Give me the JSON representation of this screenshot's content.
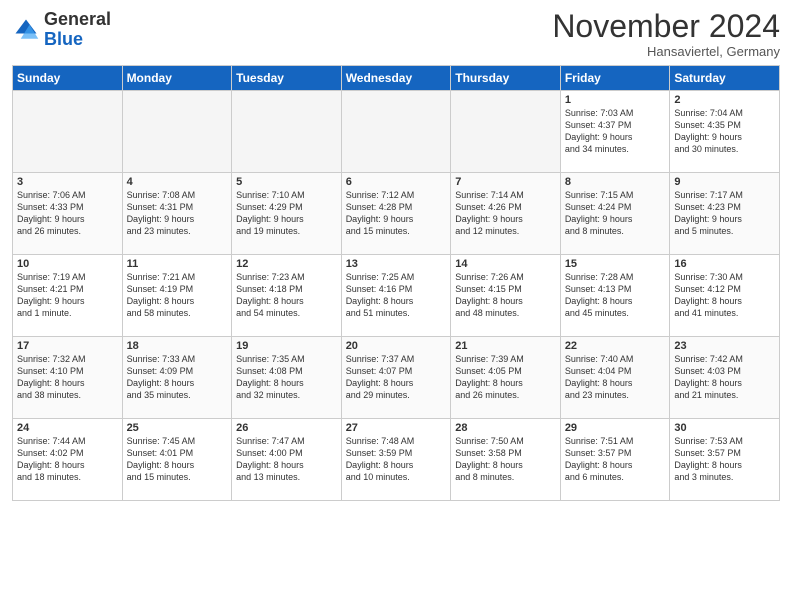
{
  "header": {
    "logo_general": "General",
    "logo_blue": "Blue",
    "month_title": "November 2024",
    "location": "Hansaviertel, Germany"
  },
  "columns": [
    "Sunday",
    "Monday",
    "Tuesday",
    "Wednesday",
    "Thursday",
    "Friday",
    "Saturday"
  ],
  "weeks": [
    [
      {
        "day": "",
        "info": ""
      },
      {
        "day": "",
        "info": ""
      },
      {
        "day": "",
        "info": ""
      },
      {
        "day": "",
        "info": ""
      },
      {
        "day": "",
        "info": ""
      },
      {
        "day": "1",
        "info": "Sunrise: 7:03 AM\nSunset: 4:37 PM\nDaylight: 9 hours\nand 34 minutes."
      },
      {
        "day": "2",
        "info": "Sunrise: 7:04 AM\nSunset: 4:35 PM\nDaylight: 9 hours\nand 30 minutes."
      }
    ],
    [
      {
        "day": "3",
        "info": "Sunrise: 7:06 AM\nSunset: 4:33 PM\nDaylight: 9 hours\nand 26 minutes."
      },
      {
        "day": "4",
        "info": "Sunrise: 7:08 AM\nSunset: 4:31 PM\nDaylight: 9 hours\nand 23 minutes."
      },
      {
        "day": "5",
        "info": "Sunrise: 7:10 AM\nSunset: 4:29 PM\nDaylight: 9 hours\nand 19 minutes."
      },
      {
        "day": "6",
        "info": "Sunrise: 7:12 AM\nSunset: 4:28 PM\nDaylight: 9 hours\nand 15 minutes."
      },
      {
        "day": "7",
        "info": "Sunrise: 7:14 AM\nSunset: 4:26 PM\nDaylight: 9 hours\nand 12 minutes."
      },
      {
        "day": "8",
        "info": "Sunrise: 7:15 AM\nSunset: 4:24 PM\nDaylight: 9 hours\nand 8 minutes."
      },
      {
        "day": "9",
        "info": "Sunrise: 7:17 AM\nSunset: 4:23 PM\nDaylight: 9 hours\nand 5 minutes."
      }
    ],
    [
      {
        "day": "10",
        "info": "Sunrise: 7:19 AM\nSunset: 4:21 PM\nDaylight: 9 hours\nand 1 minute."
      },
      {
        "day": "11",
        "info": "Sunrise: 7:21 AM\nSunset: 4:19 PM\nDaylight: 8 hours\nand 58 minutes."
      },
      {
        "day": "12",
        "info": "Sunrise: 7:23 AM\nSunset: 4:18 PM\nDaylight: 8 hours\nand 54 minutes."
      },
      {
        "day": "13",
        "info": "Sunrise: 7:25 AM\nSunset: 4:16 PM\nDaylight: 8 hours\nand 51 minutes."
      },
      {
        "day": "14",
        "info": "Sunrise: 7:26 AM\nSunset: 4:15 PM\nDaylight: 8 hours\nand 48 minutes."
      },
      {
        "day": "15",
        "info": "Sunrise: 7:28 AM\nSunset: 4:13 PM\nDaylight: 8 hours\nand 45 minutes."
      },
      {
        "day": "16",
        "info": "Sunrise: 7:30 AM\nSunset: 4:12 PM\nDaylight: 8 hours\nand 41 minutes."
      }
    ],
    [
      {
        "day": "17",
        "info": "Sunrise: 7:32 AM\nSunset: 4:10 PM\nDaylight: 8 hours\nand 38 minutes."
      },
      {
        "day": "18",
        "info": "Sunrise: 7:33 AM\nSunset: 4:09 PM\nDaylight: 8 hours\nand 35 minutes."
      },
      {
        "day": "19",
        "info": "Sunrise: 7:35 AM\nSunset: 4:08 PM\nDaylight: 8 hours\nand 32 minutes."
      },
      {
        "day": "20",
        "info": "Sunrise: 7:37 AM\nSunset: 4:07 PM\nDaylight: 8 hours\nand 29 minutes."
      },
      {
        "day": "21",
        "info": "Sunrise: 7:39 AM\nSunset: 4:05 PM\nDaylight: 8 hours\nand 26 minutes."
      },
      {
        "day": "22",
        "info": "Sunrise: 7:40 AM\nSunset: 4:04 PM\nDaylight: 8 hours\nand 23 minutes."
      },
      {
        "day": "23",
        "info": "Sunrise: 7:42 AM\nSunset: 4:03 PM\nDaylight: 8 hours\nand 21 minutes."
      }
    ],
    [
      {
        "day": "24",
        "info": "Sunrise: 7:44 AM\nSunset: 4:02 PM\nDaylight: 8 hours\nand 18 minutes."
      },
      {
        "day": "25",
        "info": "Sunrise: 7:45 AM\nSunset: 4:01 PM\nDaylight: 8 hours\nand 15 minutes."
      },
      {
        "day": "26",
        "info": "Sunrise: 7:47 AM\nSunset: 4:00 PM\nDaylight: 8 hours\nand 13 minutes."
      },
      {
        "day": "27",
        "info": "Sunrise: 7:48 AM\nSunset: 3:59 PM\nDaylight: 8 hours\nand 10 minutes."
      },
      {
        "day": "28",
        "info": "Sunrise: 7:50 AM\nSunset: 3:58 PM\nDaylight: 8 hours\nand 8 minutes."
      },
      {
        "day": "29",
        "info": "Sunrise: 7:51 AM\nSunset: 3:57 PM\nDaylight: 8 hours\nand 6 minutes."
      },
      {
        "day": "30",
        "info": "Sunrise: 7:53 AM\nSunset: 3:57 PM\nDaylight: 8 hours\nand 3 minutes."
      }
    ]
  ]
}
